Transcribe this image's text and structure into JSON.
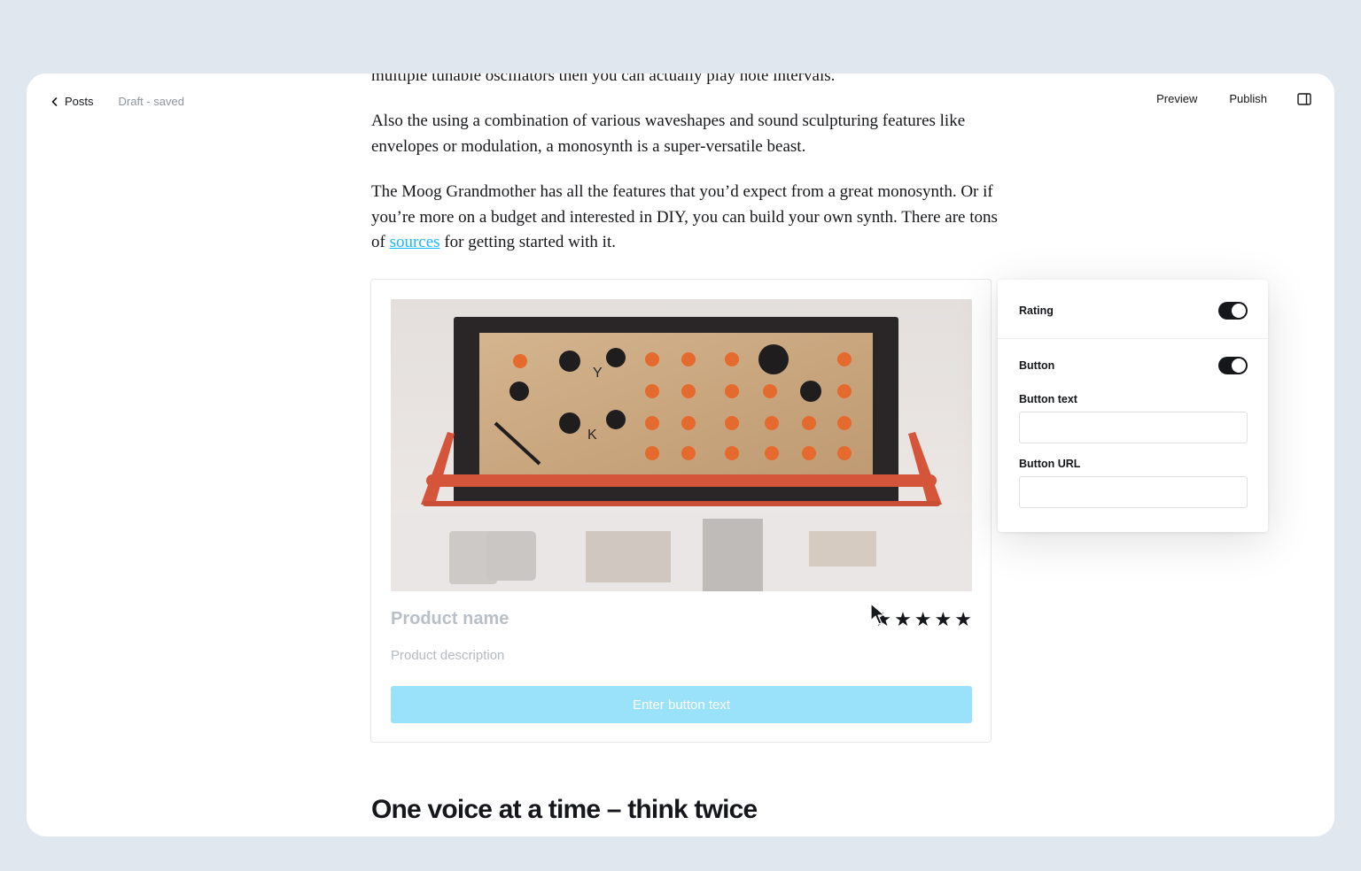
{
  "topbar": {
    "back_label": "Posts",
    "draft_status": "Draft - saved",
    "preview_label": "Preview",
    "publish_label": "Publish"
  },
  "article": {
    "clipped_line": "multiple tunable oscillators then you can actually play note intervals.",
    "para1": "Also the using a combination of various waveshapes and sound sculpturing features like envelopes or modulation, a monosynth is a super-versatile beast.",
    "para2_part1": "The Moog Grandmother has all the features that you’d expect from a great monosynth. Or if you’re more on a budget and interested in DIY, you can build your own synth. There are tons of ",
    "para2_link": "sources",
    "para2_part2": " for getting started with it.",
    "heading": "One voice at a time – think twice"
  },
  "product_card": {
    "name_placeholder": "Product name",
    "rating": 5,
    "rating_max": 5,
    "description_placeholder": "Product description",
    "button_placeholder": "Enter button text",
    "image_panel_letters": [
      "Y",
      "K"
    ]
  },
  "settings_panel": {
    "rating_label": "Rating",
    "rating_enabled": true,
    "button_label": "Button",
    "button_enabled": true,
    "button_text_label": "Button text",
    "button_text_value": "",
    "button_url_label": "Button URL",
    "button_url_value": ""
  },
  "colors": {
    "background": "#e1e7ef",
    "link": "#14b8ff",
    "product_button": "#9ae2fa",
    "toggle_on": "#15171a"
  }
}
